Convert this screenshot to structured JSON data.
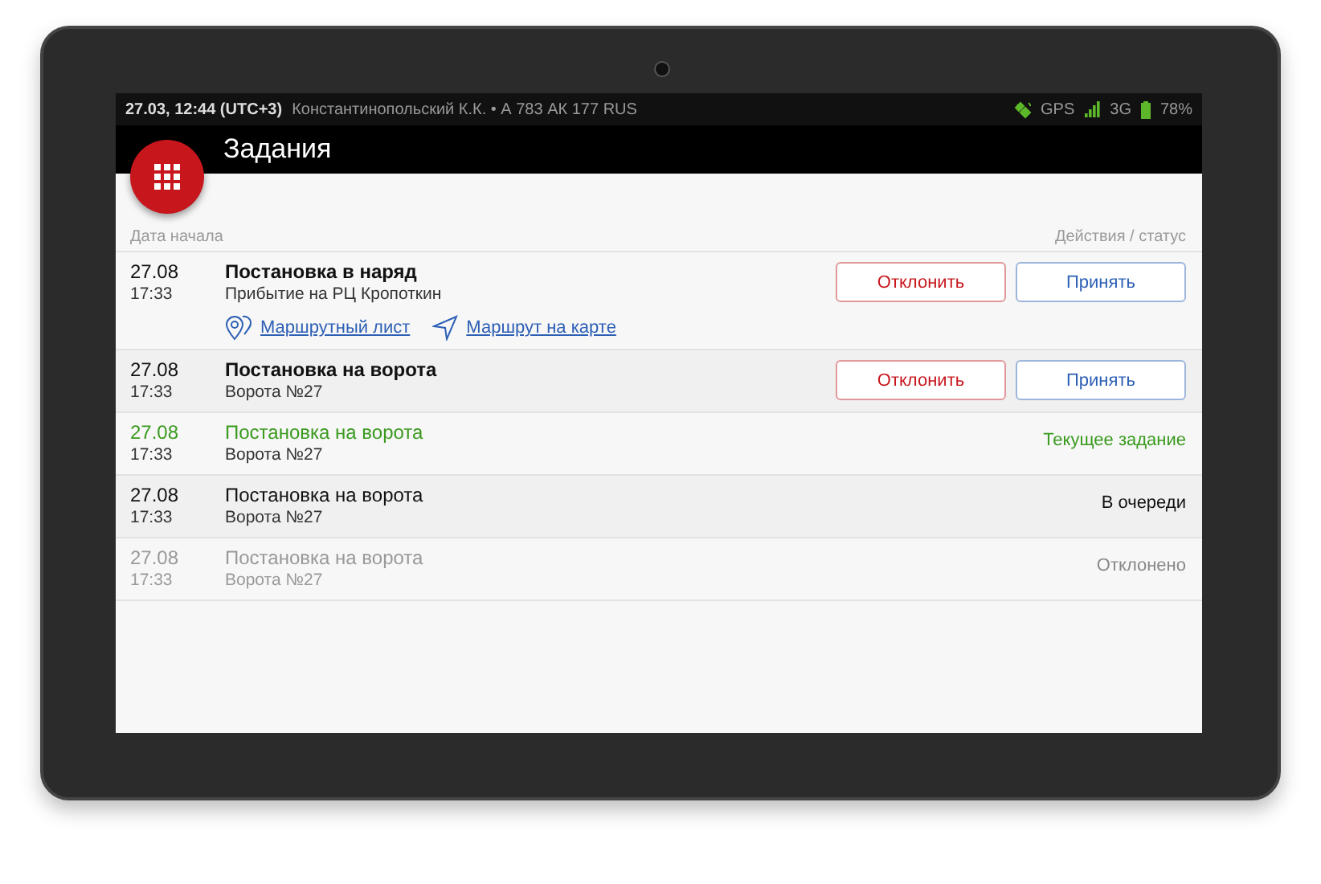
{
  "status_bar": {
    "time": "27.03, 12:44 (UTC+3)",
    "info": "Константинопольский К.К. • А 783 АК 177 RUS",
    "gps": "GPS",
    "network": "3G",
    "battery": "78%"
  },
  "app_bar": {
    "title": "Задания"
  },
  "table": {
    "columns": [
      "Дата начала",
      "Действия / статус"
    ],
    "rows": [
      {
        "kind": "pending",
        "date": "27.08",
        "time": "17:33",
        "title": "Постановка в наряд",
        "subtitle": "Прибытие на РЦ Кропоткин",
        "links": [
          {
            "kind": "route_sheet",
            "label": "Маршрутный лист"
          },
          {
            "kind": "map",
            "label": "Маршрут на карте"
          }
        ],
        "actions": [
          {
            "kind": "reject",
            "label": "Отклонить"
          },
          {
            "kind": "accept",
            "label": "Принять"
          }
        ]
      },
      {
        "kind": "pending",
        "date": "27.08",
        "time": "17:33",
        "title": "Постановка на ворота",
        "subtitle": "Ворота №27",
        "actions": [
          {
            "kind": "reject",
            "label": "Отклонить"
          },
          {
            "kind": "accept",
            "label": "Принять"
          }
        ]
      },
      {
        "kind": "current",
        "date": "27.08",
        "time": "17:33",
        "title": "Постановка на ворота",
        "subtitle": "Ворота №27",
        "status": "Текущее задание"
      },
      {
        "kind": "queued",
        "date": "27.08",
        "time": "17:33",
        "title": "Постановка на ворота",
        "subtitle": "Ворота №27",
        "status": "В очереди"
      },
      {
        "kind": "rejected",
        "date": "27.08",
        "time": "17:33",
        "title": "Постановка на ворота",
        "subtitle": "Ворота №27",
        "status": "Отклонено"
      }
    ]
  }
}
